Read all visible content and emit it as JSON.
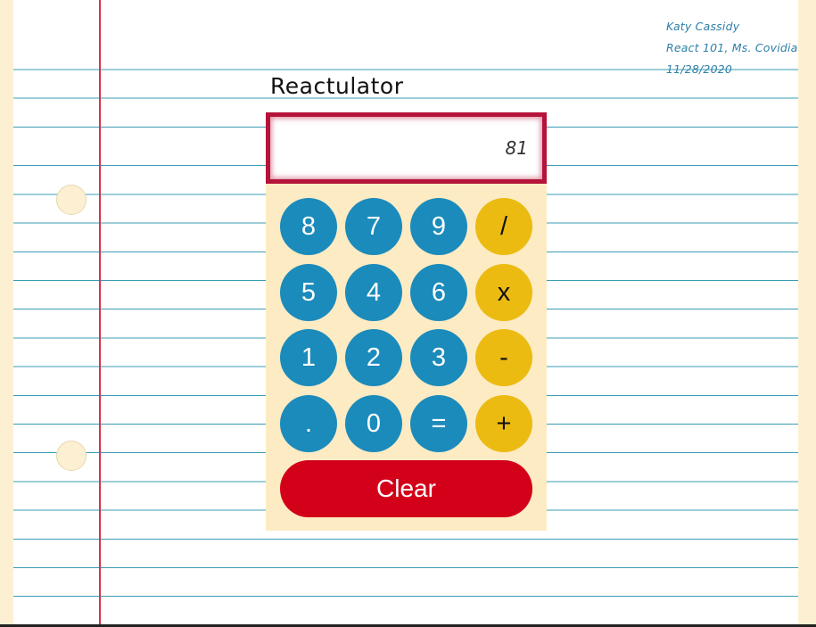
{
  "app": {
    "title": "Reactulator"
  },
  "student": {
    "name": "Katy Cassidy",
    "course": "React 101, Ms. Covidia",
    "date": "11/28/2020"
  },
  "display": {
    "value": "81"
  },
  "keypad": {
    "rows": [
      [
        {
          "label": "8",
          "kind": "number"
        },
        {
          "label": "7",
          "kind": "number"
        },
        {
          "label": "9",
          "kind": "number"
        },
        {
          "label": "/",
          "kind": "operator"
        }
      ],
      [
        {
          "label": "5",
          "kind": "number"
        },
        {
          "label": "4",
          "kind": "number"
        },
        {
          "label": "6",
          "kind": "number"
        },
        {
          "label": "x",
          "kind": "operator"
        }
      ],
      [
        {
          "label": "1",
          "kind": "number"
        },
        {
          "label": "2",
          "kind": "number"
        },
        {
          "label": "3",
          "kind": "number"
        },
        {
          "label": "-",
          "kind": "operator"
        }
      ],
      [
        {
          "label": ".",
          "kind": "number"
        },
        {
          "label": "0",
          "kind": "number"
        },
        {
          "label": "=",
          "kind": "number"
        },
        {
          "label": "+",
          "kind": "operator"
        }
      ]
    ],
    "clear_label": "Clear"
  },
  "colors": {
    "number_button": "#1b8bbb",
    "operator_button": "#ecbb12",
    "clear_button": "#d30019",
    "display_border": "#b5133a",
    "margin_line": "#d8324e",
    "ruled_line": "#3a9cb5",
    "background": "#fdf0d2"
  }
}
